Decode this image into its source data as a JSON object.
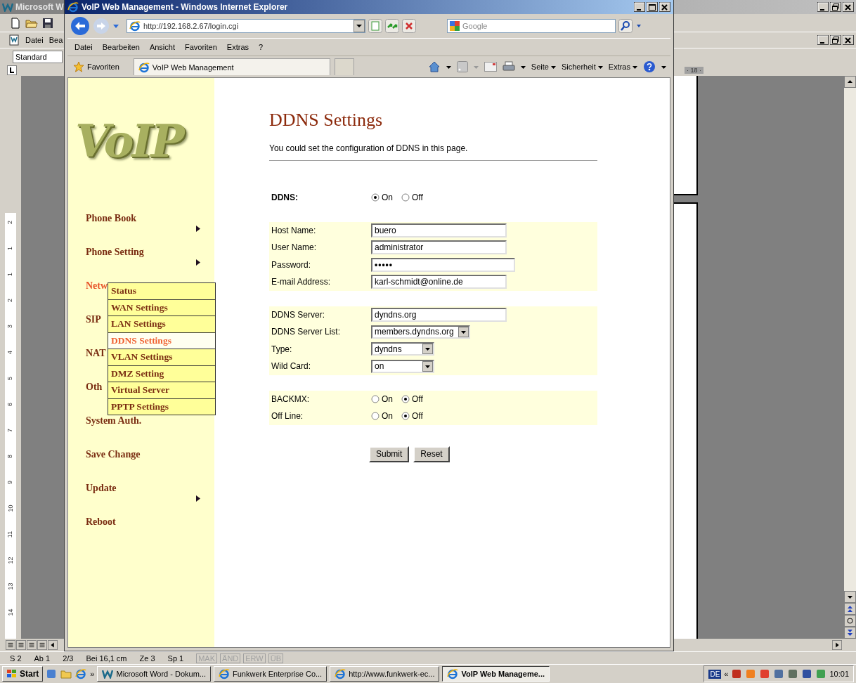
{
  "word": {
    "title": "Microsoft W",
    "menu": [
      "Datei",
      "Bea"
    ],
    "style_box": "Standard",
    "ruler_label": "· 18 ·",
    "ruler_numbers": [
      "2",
      "1",
      "1",
      "2",
      "3",
      "4",
      "5",
      "6",
      "7",
      "8",
      "9",
      "10",
      "11",
      "12",
      "13",
      "14"
    ],
    "status": [
      "S 2",
      "Ab 1",
      "2/3",
      "Bei 16,1 cm",
      "Ze 3",
      "Sp 1"
    ],
    "flags": [
      {
        "label": "MAK",
        "disabled": true
      },
      {
        "label": "ÄND",
        "disabled": true
      },
      {
        "label": "ERW",
        "disabled": true
      },
      {
        "label": "ÜB",
        "disabled": true
      }
    ]
  },
  "browser": {
    "title": "VoIP Web Management - Windows Internet Explorer",
    "address": "http://192.168.2.67/login.cgi",
    "search_placeholder": "Google",
    "menu": [
      "Datei",
      "Bearbeiten",
      "Ansicht",
      "Favoriten",
      "Extras",
      "?"
    ],
    "favorites": "Favoriten",
    "tab": "VoIP Web Management",
    "commands": [
      "Seite",
      "Sicherheit",
      "Extras"
    ]
  },
  "page": {
    "logo": "VoIP",
    "menu": [
      {
        "label": "Phone Book",
        "selected": false,
        "has_submenu": true
      },
      {
        "label": "Phone Setting",
        "selected": false,
        "has_submenu": true
      },
      {
        "label": "Netw",
        "selected": true,
        "has_submenu": false
      },
      {
        "label": "SIP",
        "selected": false,
        "has_submenu": false
      },
      {
        "label": "NAT",
        "selected": false,
        "has_submenu": false
      },
      {
        "label": "Oth",
        "selected": false,
        "has_submenu": false
      },
      {
        "label": "System Auth.",
        "selected": false,
        "has_submenu": false
      },
      {
        "label": "Save Change",
        "selected": false,
        "has_submenu": false
      },
      {
        "label": "Update",
        "selected": false,
        "has_submenu": true
      },
      {
        "label": "Reboot",
        "selected": false,
        "has_submenu": false
      }
    ],
    "submenu": [
      {
        "label": "Status",
        "selected": false
      },
      {
        "label": "WAN Settings",
        "selected": false
      },
      {
        "label": "LAN Settings",
        "selected": false
      },
      {
        "label": "DDNS Settings",
        "selected": true
      },
      {
        "label": "VLAN Settings",
        "selected": false
      },
      {
        "label": "DMZ Setting",
        "selected": false
      },
      {
        "label": "Virtual Server",
        "selected": false
      },
      {
        "label": "PPTP Settings",
        "selected": false
      }
    ],
    "title": "DDNS Settings",
    "description": "You could set the configuration of DDNS in this page.",
    "form": {
      "ddns": {
        "label": "DDNS:",
        "options": [
          {
            "label": "On",
            "selected": true
          },
          {
            "label": "Off",
            "selected": false
          }
        ]
      },
      "sections": [
        [
          {
            "kind": "text",
            "label": "Host Name:",
            "value": "buero"
          },
          {
            "kind": "text",
            "label": "User Name:",
            "value": "administrator"
          },
          {
            "kind": "password",
            "label": "Password:",
            "value": "•••••"
          },
          {
            "kind": "text",
            "label": "E-mail Address:",
            "value": "karl-schmidt@online.de"
          }
        ],
        [
          {
            "kind": "text",
            "label": "DDNS Server:",
            "value": "dyndns.org"
          },
          {
            "kind": "select",
            "label": "DDNS Server List:",
            "value": "members.dyndns.org"
          },
          {
            "kind": "select",
            "label": "Type:",
            "value": "dyndns"
          },
          {
            "kind": "select",
            "label": "Wild Card:",
            "value": "on"
          }
        ],
        [
          {
            "kind": "radio",
            "label": "BACKMX:",
            "options": [
              {
                "label": "On",
                "selected": false
              },
              {
                "label": "Off",
                "selected": true
              }
            ]
          },
          {
            "kind": "radio",
            "label": "Off Line:",
            "options": [
              {
                "label": "On",
                "selected": false
              },
              {
                "label": "Off",
                "selected": true
              }
            ]
          }
        ]
      ]
    },
    "buttons": [
      "Submit",
      "Reset"
    ]
  },
  "taskbar": {
    "start": "Start",
    "more": "»",
    "tasks": [
      {
        "label": "Microsoft Word - Dokum...",
        "kind": "document",
        "selected": false
      },
      {
        "label": "Funkwerk Enterprise Co...",
        "kind": "web",
        "selected": false
      },
      {
        "label": "http://www.funkwerk-ec...",
        "kind": "web",
        "selected": false
      },
      {
        "label": "VoIP Web Manageme...",
        "kind": "web",
        "selected": true
      }
    ],
    "language": "DE",
    "tray_expand": "«",
    "clock": "10:01"
  }
}
